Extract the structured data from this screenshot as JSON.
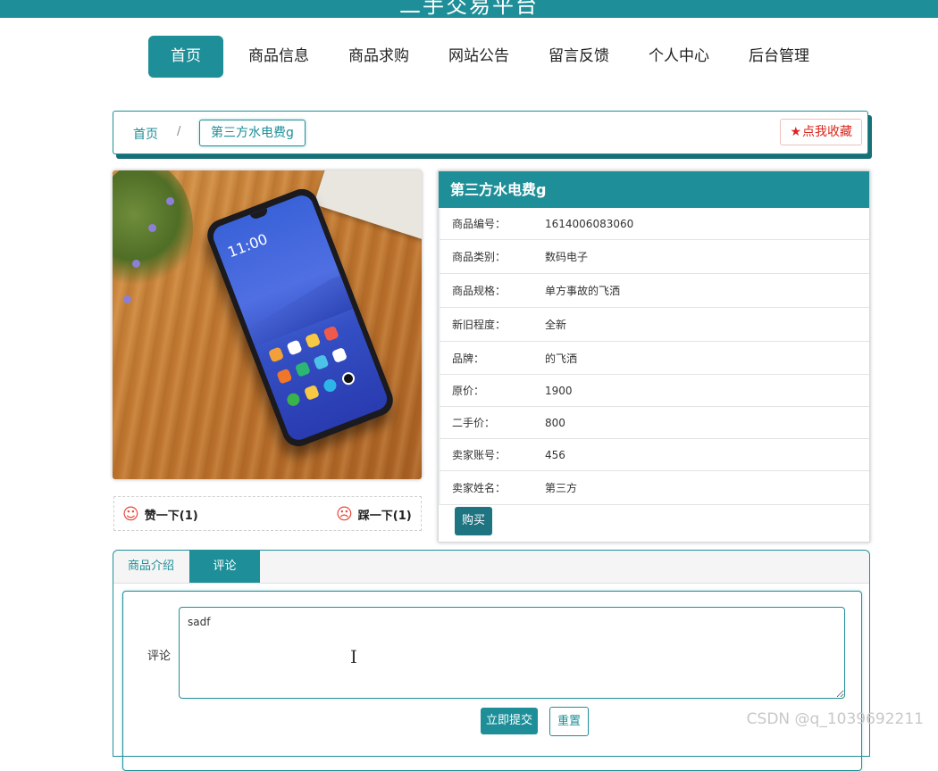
{
  "header": {
    "site_title": "二手交易平台"
  },
  "nav": [
    {
      "label": "首页",
      "active": true
    },
    {
      "label": "商品信息"
    },
    {
      "label": "商品求购"
    },
    {
      "label": "网站公告"
    },
    {
      "label": "留言反馈"
    },
    {
      "label": "个人中心"
    },
    {
      "label": "后台管理"
    }
  ],
  "breadcrumb": {
    "home": "首页",
    "separator": "/",
    "current": "第三方水电费g"
  },
  "favorite": {
    "star": "★",
    "label": "点我收藏"
  },
  "reactions": {
    "like": {
      "label": "赞一下(1)"
    },
    "dislike": {
      "label": "踩一下(1)"
    }
  },
  "product": {
    "title": "第三方水电费g",
    "phone_time": "11:00",
    "rows": [
      {
        "label": "商品编号：",
        "value": "1614006083060"
      },
      {
        "label": "商品类别：",
        "value": "数码电子"
      },
      {
        "label": "商品规格：",
        "value": "单方事故的飞洒"
      },
      {
        "label": "新旧程度：",
        "value": "全新"
      },
      {
        "label": "品牌：",
        "value": "的飞洒"
      },
      {
        "label": "原价：",
        "value": "1900"
      },
      {
        "label": "二手价：",
        "value": "800"
      },
      {
        "label": "卖家账号：",
        "value": "456"
      },
      {
        "label": "卖家姓名：",
        "value": "第三方"
      }
    ],
    "buy_label": "购买"
  },
  "tabs": [
    {
      "label": "商品介绍",
      "active": false
    },
    {
      "label": "评论",
      "active": true
    }
  ],
  "comment": {
    "label": "评论",
    "value": "sadf",
    "submit_label": "立即提交",
    "reset_label": "重置"
  },
  "watermark": "CSDN @q_1039692211",
  "colors": {
    "accent": "#1e8f98",
    "favorite": "#d9251c",
    "reaction_icon": "#e8483b"
  }
}
